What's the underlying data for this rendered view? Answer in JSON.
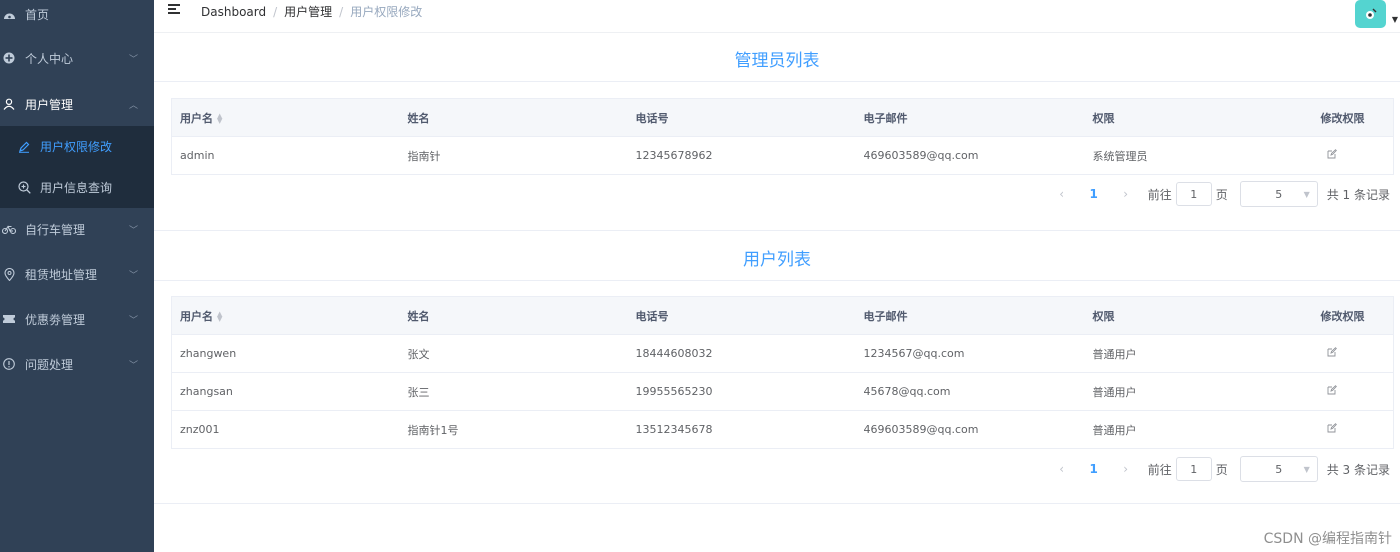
{
  "sidebar": {
    "items": [
      {
        "label": "首页",
        "icon": "dashboard-icon"
      },
      {
        "label": "个人中心",
        "icon": "plus-circle-icon"
      },
      {
        "label": "用户管理",
        "icon": "user-icon"
      },
      {
        "label": "自行车管理",
        "icon": "bicycle-icon"
      },
      {
        "label": "租赁地址管理",
        "icon": "location-pin-icon"
      },
      {
        "label": "优惠劵管理",
        "icon": "ticket-icon"
      },
      {
        "label": "问题处理",
        "icon": "info-circle-icon"
      }
    ],
    "sub_items": [
      {
        "label": "用户权限修改",
        "icon": "edit-icon",
        "active": true
      },
      {
        "label": "用户信息查询",
        "icon": "zoom-in-icon",
        "active": false
      }
    ]
  },
  "breadcrumb": [
    "Dashboard",
    "用户管理",
    "用户权限修改"
  ],
  "admin_section": {
    "title": "管理员列表",
    "columns": [
      "用户名",
      "姓名",
      "电话号",
      "电子邮件",
      "权限",
      "修改权限"
    ],
    "rows": [
      [
        "admin",
        "指南针",
        "12345678962",
        "469603589@qq.com",
        "系统管理员"
      ]
    ],
    "pagination": {
      "page": "1",
      "goto_label": "前往",
      "goto_value": "1",
      "page_unit": "页",
      "page_size": "5",
      "total": "共 1 条记录"
    }
  },
  "user_section": {
    "title": "用户列表",
    "columns": [
      "用户名",
      "姓名",
      "电话号",
      "电子邮件",
      "权限",
      "修改权限"
    ],
    "rows": [
      [
        "zhangwen",
        "张文",
        "18444608032",
        "1234567@qq.com",
        "普通用户"
      ],
      [
        "zhangsan",
        "张三",
        "19955565230",
        "45678@qq.com",
        "普通用户"
      ],
      [
        "znz001",
        "指南针1号",
        "13512345678",
        "469603589@qq.com",
        "普通用户"
      ]
    ],
    "pagination": {
      "page": "1",
      "goto_label": "前往",
      "goto_value": "1",
      "page_unit": "页",
      "page_size": "5",
      "total": "共 3 条记录"
    }
  },
  "watermark": "CSDN @编程指南针",
  "colors": {
    "sidebar_bg": "#304156",
    "submenu_bg": "#1f2d3d",
    "accent": "#409eff",
    "avatar_bg": "#54d4d0"
  }
}
